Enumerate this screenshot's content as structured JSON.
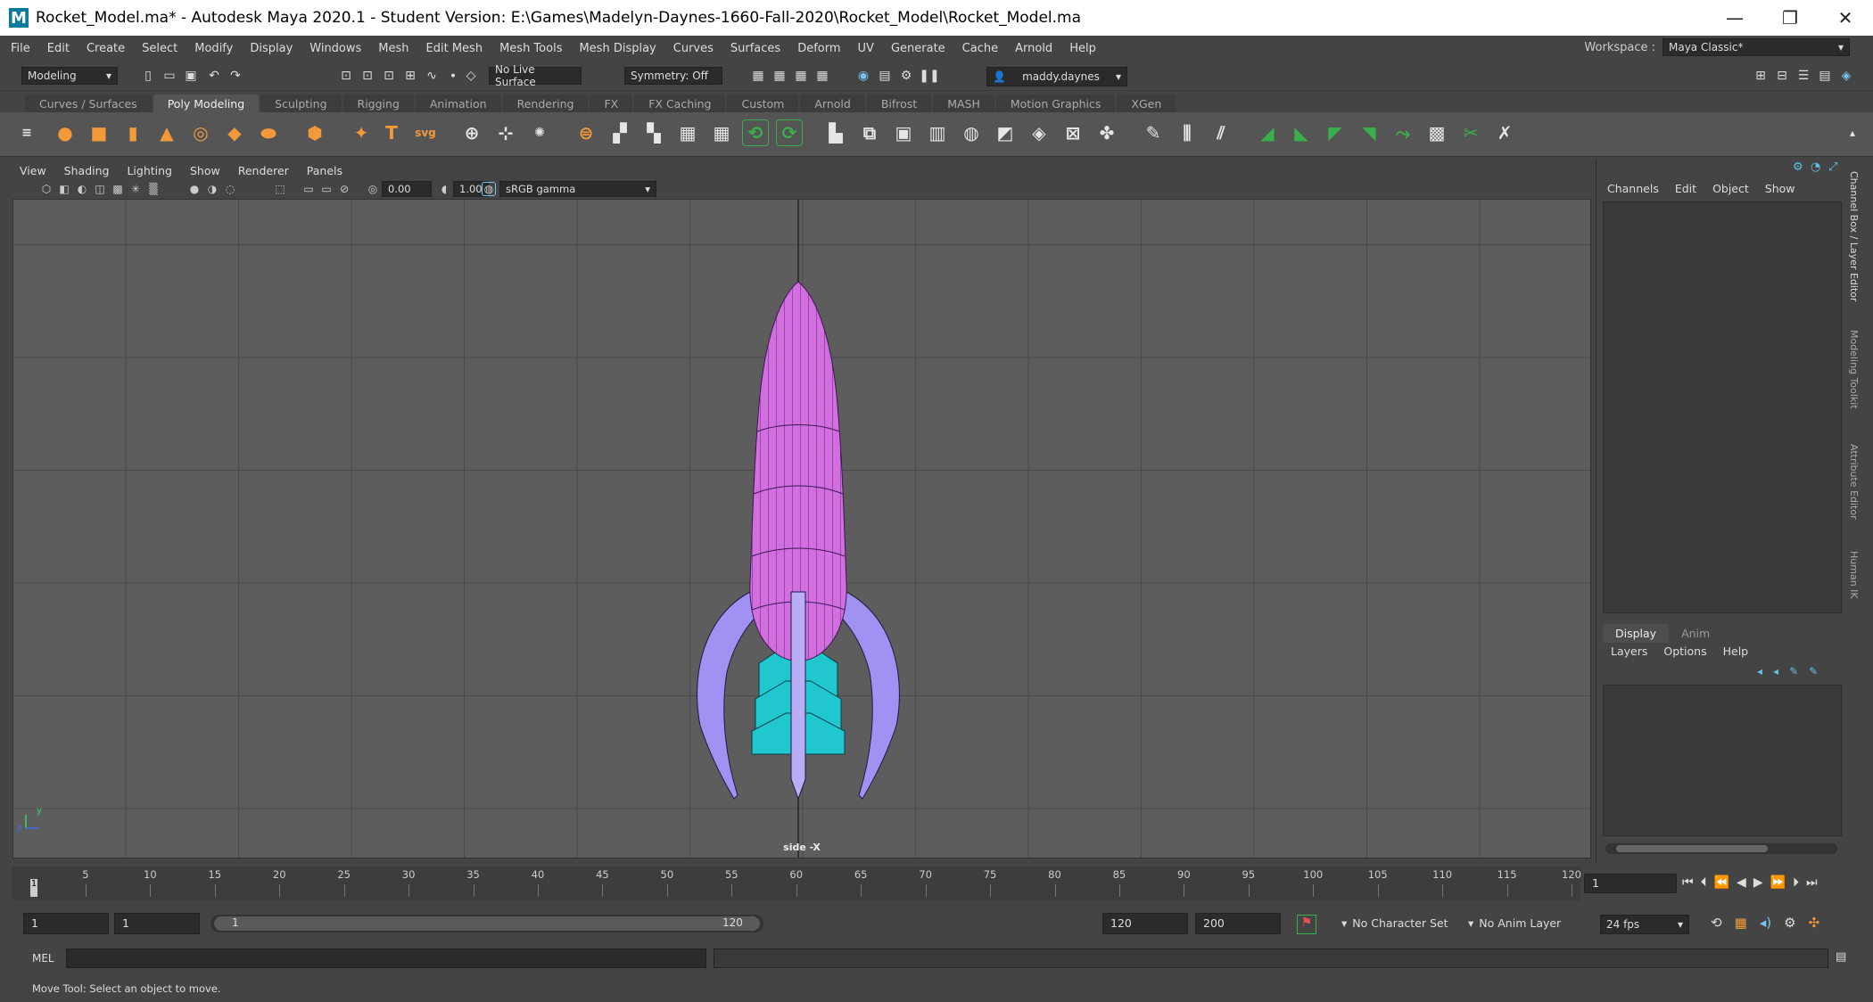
{
  "window": {
    "title": "Rocket_Model.ma* - Autodesk Maya 2020.1 - Student Version: E:\\Games\\Madelyn-Daynes-1660-Fall-2020\\Rocket_Model\\Rocket_Model.ma",
    "logo": "M",
    "minimize": "—",
    "restore": "❐",
    "close": "✕"
  },
  "menu": [
    "File",
    "Edit",
    "Create",
    "Select",
    "Modify",
    "Display",
    "Windows",
    "Mesh",
    "Edit Mesh",
    "Mesh Tools",
    "Mesh Display",
    "Curves",
    "Surfaces",
    "Deform",
    "UV",
    "Generate",
    "Cache",
    "Arnold",
    "Help"
  ],
  "workspace": {
    "label": "Workspace :",
    "value": "Maya Classic*"
  },
  "status": {
    "mode": "Modeling",
    "live_surface": "No Live Surface",
    "symmetry": "Symmetry: Off",
    "user": "maddy.daynes"
  },
  "shelf_tabs": [
    "Curves / Surfaces",
    "Poly Modeling",
    "Sculpting",
    "Rigging",
    "Animation",
    "Rendering",
    "FX",
    "FX Caching",
    "Custom",
    "Arnold",
    "Bifrost",
    "MASH",
    "Motion Graphics",
    "XGen"
  ],
  "shelf_active": "Poly Modeling",
  "viewport_menu": [
    "View",
    "Shading",
    "Lighting",
    "Show",
    "Renderer",
    "Panels"
  ],
  "viewport_toolbar": {
    "exposure": "0.00",
    "gamma": "1.00",
    "colorspace": "sRGB gamma"
  },
  "viewport_label": "side -X",
  "axis": {
    "y": "y",
    "z": "z"
  },
  "channel_box": {
    "menu": [
      "Channels",
      "Edit",
      "Object",
      "Show"
    ]
  },
  "layer_editor": {
    "tabs": [
      "Display",
      "Anim"
    ],
    "menu": [
      "Layers",
      "Options",
      "Help"
    ]
  },
  "side_tabs": [
    "Channel Box / Layer Editor",
    "Modeling Toolkit",
    "Attribute Editor",
    "Human IK"
  ],
  "timeline": {
    "ticks": [
      "5",
      "10",
      "15",
      "20",
      "25",
      "30",
      "35",
      "40",
      "45",
      "50",
      "55",
      "60",
      "65",
      "70",
      "75",
      "80",
      "85",
      "90",
      "95",
      "100",
      "105",
      "110",
      "115",
      "120"
    ],
    "start_marker": "1",
    "current_frame": "1"
  },
  "range": {
    "start": "1",
    "anim_start": "1",
    "slider_start": "1",
    "slider_end": "120",
    "end": "120",
    "anim_end": "200",
    "character_set": "No Character Set",
    "anim_layer": "No Anim Layer",
    "fps": "24 fps"
  },
  "mel": {
    "label": "MEL"
  },
  "helpline": "Move Tool: Select an object to move.",
  "colors": {
    "rocket_body": "#d26ee0",
    "fins": "#9f8ff0",
    "flames": "#22c3cc",
    "viewport_bg": "#5d5d5d"
  }
}
